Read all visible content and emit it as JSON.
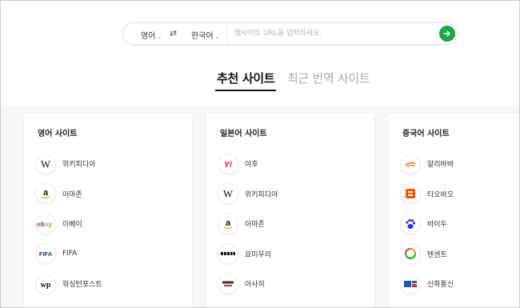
{
  "translate_bar": {
    "source_lang": "영어",
    "target_lang": "한국어",
    "url_placeholder": "웹사이트 URL을 입력하세요.",
    "go_icon": "arrow-right-icon",
    "swap_icon": "swap-icon",
    "accent_color": "#1ca649"
  },
  "tabs": [
    {
      "label": "추천 사이트",
      "active": true
    },
    {
      "label": "최근 번역 사이트",
      "active": false
    }
  ],
  "cards": [
    {
      "title": "영어 사이트",
      "sites": [
        {
          "name": "위키피디아",
          "logo": "wikipedia-logo"
        },
        {
          "name": "아마존",
          "logo": "amazon-logo"
        },
        {
          "name": "이베이",
          "logo": "ebay-logo"
        },
        {
          "name": "FIFA",
          "logo": "fifa-logo"
        },
        {
          "name": "워싱턴포스트",
          "logo": "washington-post-logo"
        }
      ]
    },
    {
      "title": "일본어 사이트",
      "sites": [
        {
          "name": "야후",
          "logo": "yahoo-logo"
        },
        {
          "name": "위키피디아",
          "logo": "wikipedia-logo"
        },
        {
          "name": "아마존",
          "logo": "amazon-logo"
        },
        {
          "name": "요미우리",
          "logo": "yomiuri-logo"
        },
        {
          "name": "아사히",
          "logo": "asahi-logo"
        }
      ]
    },
    {
      "title": "중국어 사이트",
      "sites": [
        {
          "name": "알리바바",
          "logo": "alibaba-logo"
        },
        {
          "name": "타오바오",
          "logo": "taobao-logo"
        },
        {
          "name": "바이두",
          "logo": "baidu-logo"
        },
        {
          "name": "텐센트",
          "logo": "tencent-logo"
        },
        {
          "name": "신화통신",
          "logo": "xinhua-logo"
        }
      ]
    }
  ]
}
